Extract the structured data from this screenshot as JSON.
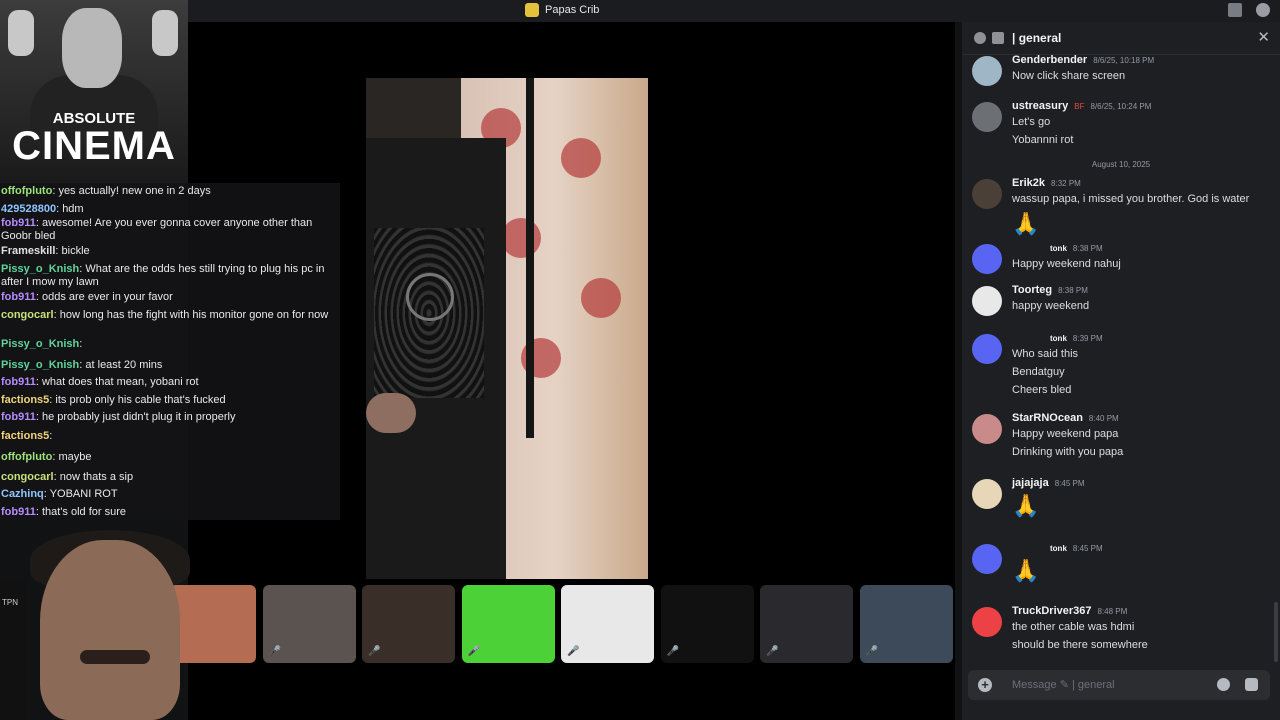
{
  "window": {
    "title": "Papas Crib"
  },
  "meme": {
    "line1": "ABSOLUTE",
    "line2": "CINEMA"
  },
  "stream_chat": [
    {
      "user": "offofpluto",
      "color": "#9be37a",
      "text": "yes actually! new one in 2 days"
    },
    {
      "user": "429528800",
      "color": "#8ec5ff",
      "text": "hdm"
    },
    {
      "user": "fob911",
      "color": "#b58cff",
      "text": "awesome! Are you ever gonna cover anyone other than Goobr bled"
    },
    {
      "user": "Frameskill",
      "color": "#e0e0e0",
      "text": "bickle"
    },
    {
      "user": "Pissy_o_Knish",
      "color": "#5fd39a",
      "text": "What are the odds hes still trying to plug his pc in after I mow my lawn"
    },
    {
      "user": "fob911",
      "color": "#b58cff",
      "text": "odds are ever in your favor"
    },
    {
      "user": "congocarl",
      "color": "#c6e27a",
      "text": "how long has the fight with his monitor gone on for now"
    },
    {
      "user": "Pissy_o_Knish",
      "color": "#5fd39a",
      "text": ""
    },
    {
      "user": "Pissy_o_Knish",
      "color": "#5fd39a",
      "text": "at least 20 mins"
    },
    {
      "user": "fob911",
      "color": "#b58cff",
      "text": "what does that mean, yobani rot"
    },
    {
      "user": "factions5",
      "color": "#f0d37a",
      "text": "its prob only his cable that's fucked"
    },
    {
      "user": "fob911",
      "color": "#b58cff",
      "text": "he probably just didn't plug it in properly"
    },
    {
      "user": "factions5",
      "color": "#f0d37a",
      "text": ""
    },
    {
      "user": "offofpluto",
      "color": "#9be37a",
      "text": "maybe"
    },
    {
      "user": "congocarl",
      "color": "#c6e27a",
      "text": "now thats a sip"
    },
    {
      "user": "Cazhinq",
      "color": "#8ec5ff",
      "text": "YOBANI ROT"
    },
    {
      "user": "fob911",
      "color": "#b58cff",
      "text": "that's old for sure"
    }
  ],
  "sidebar_mini": {
    "label1": "TPN"
  },
  "tiles": [
    {
      "name": "participant-1",
      "bg": "#b46c52"
    },
    {
      "name": "participant-2",
      "bg": "#5a5350"
    },
    {
      "name": "participant-3",
      "bg": "#3a2e28"
    },
    {
      "name": "participant-k",
      "bg": "#4cd137"
    },
    {
      "name": "participant-chess",
      "bg": "#e8e8e8"
    },
    {
      "name": "participant-a",
      "bg": "#111111"
    },
    {
      "name": "participant-7",
      "bg": "#2a2a2e"
    },
    {
      "name": "participant-8",
      "bg": "#3c4a5a"
    }
  ],
  "channel": {
    "name": "| general",
    "composer_placeholder": "Message ✎ | general"
  },
  "date_separator": "August 10, 2025",
  "messages": [
    {
      "user": "Genderbender",
      "time": "8/6/25, 10:18 PM",
      "lines": [
        "Now click share screen"
      ],
      "avatar": "#9fb6c6"
    },
    {
      "user": "ustreasury",
      "time": "8/6/25, 10:24 PM",
      "lines": [
        "Let's go",
        "Yobannni rot"
      ],
      "avatar": "#6c7075",
      "tag": "BF"
    },
    {
      "user": "Erik2k",
      "time": "8:32 PM",
      "lines": [
        "wassup papa, i missed you brother. God is water"
      ],
      "avatar": "#4a4038",
      "emoji": "🙏"
    },
    {
      "user": "",
      "time": "8:38 PM",
      "lines": [
        "Happy weekend nahuj"
      ],
      "avatar": "#5865f2",
      "reply": "tonk"
    },
    {
      "user": "Toorteg",
      "time": "8:38 PM",
      "lines": [
        "happy weekend"
      ],
      "avatar": "#e8e8e8"
    },
    {
      "user": "",
      "time": "8:39 PM",
      "lines": [
        "Who said this",
        "Bendatguy",
        "Cheers bled"
      ],
      "avatar": "#5865f2",
      "reply": "tonk"
    },
    {
      "user": "StarRNOcean",
      "time": "8:40 PM",
      "lines": [
        "Happy weekend papa",
        "Drinking with you papa"
      ],
      "avatar": "#c98a8a"
    },
    {
      "user": "jajajaja",
      "time": "8:45 PM",
      "lines": [],
      "avatar": "#e8d6b8",
      "emoji": "🙏"
    },
    {
      "user": "",
      "time": "8:45 PM",
      "lines": [],
      "avatar": "#5865f2",
      "reply": "tonk",
      "emoji": "🙏"
    },
    {
      "user": "TruckDriver367",
      "time": "8:48 PM",
      "lines": [
        "the other cable was hdmi",
        "should be there somewhere"
      ],
      "avatar": "#ed4245"
    }
  ]
}
